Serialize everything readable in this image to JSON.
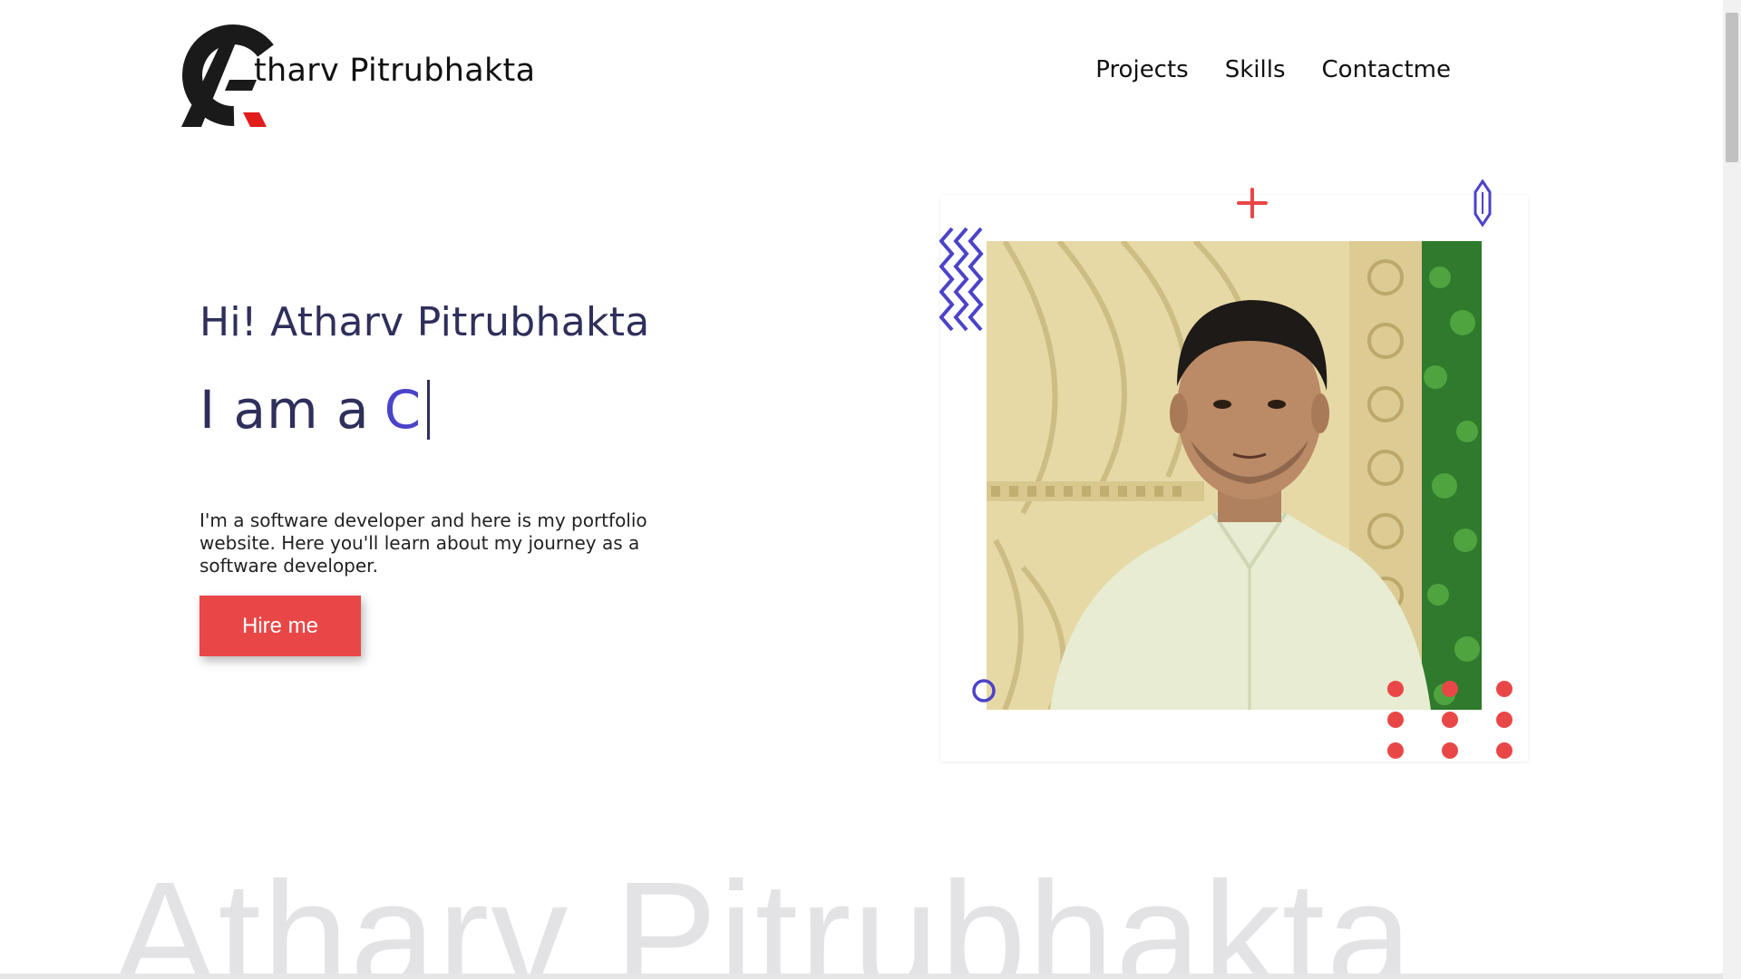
{
  "header": {
    "brand_name": "tharv Pitrubhakta",
    "logo_icon": "atharv-logo-icon",
    "nav": [
      {
        "label": "Projects"
      },
      {
        "label": "Skills"
      },
      {
        "label": "Contactme"
      }
    ]
  },
  "hero": {
    "greeting": "Hi! Atharv Pitrubhakta",
    "role_prefix": "I am a",
    "role_typed": "C",
    "intro": "I'm a software developer and here is my portfolio website. Here you'll learn about my journey as a software developer.",
    "hire_button": "Hire me"
  },
  "watermark": "Atharv Pitrubhakta",
  "colors": {
    "accent_red": "#e94747",
    "accent_purple": "#4b43c9",
    "text_dark": "#2f2f5c"
  }
}
